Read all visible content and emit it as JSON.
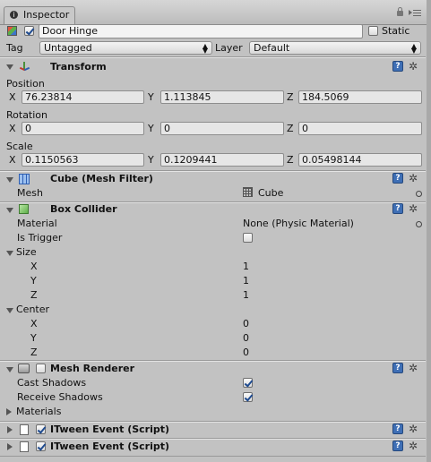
{
  "tab": {
    "title": "Inspector"
  },
  "object": {
    "name": "Door Hinge",
    "active": true,
    "static_label": "Static",
    "static": false,
    "tag_label": "Tag",
    "tag_value": "Untagged",
    "layer_label": "Layer",
    "layer_value": "Default"
  },
  "transform": {
    "title": "Transform",
    "position_label": "Position",
    "rotation_label": "Rotation",
    "scale_label": "Scale",
    "axis_x": "X",
    "axis_y": "Y",
    "axis_z": "Z",
    "position": {
      "x": "76.23814",
      "y": "1.113845",
      "z": "184.5069"
    },
    "rotation": {
      "x": "0",
      "y": "0",
      "z": "0"
    },
    "scale": {
      "x": "0.1150563",
      "y": "0.1209441",
      "z": "0.05498144"
    }
  },
  "mesh_filter": {
    "title": "Cube (Mesh Filter)",
    "mesh_label": "Mesh",
    "mesh_value": "Cube"
  },
  "box_collider": {
    "title": "Box Collider",
    "material_label": "Material",
    "material_value": "None (Physic Material)",
    "is_trigger_label": "Is Trigger",
    "is_trigger": false,
    "size_label": "Size",
    "size": {
      "x": "1",
      "y": "1",
      "z": "1"
    },
    "center_label": "Center",
    "center": {
      "x": "0",
      "y": "0",
      "z": "0"
    },
    "axis_x": "X",
    "axis_y": "Y",
    "axis_z": "Z"
  },
  "mesh_renderer": {
    "title": "Mesh Renderer",
    "enabled": false,
    "cast_shadows_label": "Cast Shadows",
    "cast_shadows": true,
    "receive_shadows_label": "Receive Shadows",
    "receive_shadows": true,
    "materials_label": "Materials"
  },
  "scripts": [
    {
      "title": "ITween Event (Script)",
      "enabled": true
    },
    {
      "title": "ITween Event (Script)",
      "enabled": true
    }
  ],
  "icons": {
    "help": "?",
    "gear": "✲",
    "lock": "lock-icon",
    "menu": "menu-icon"
  }
}
